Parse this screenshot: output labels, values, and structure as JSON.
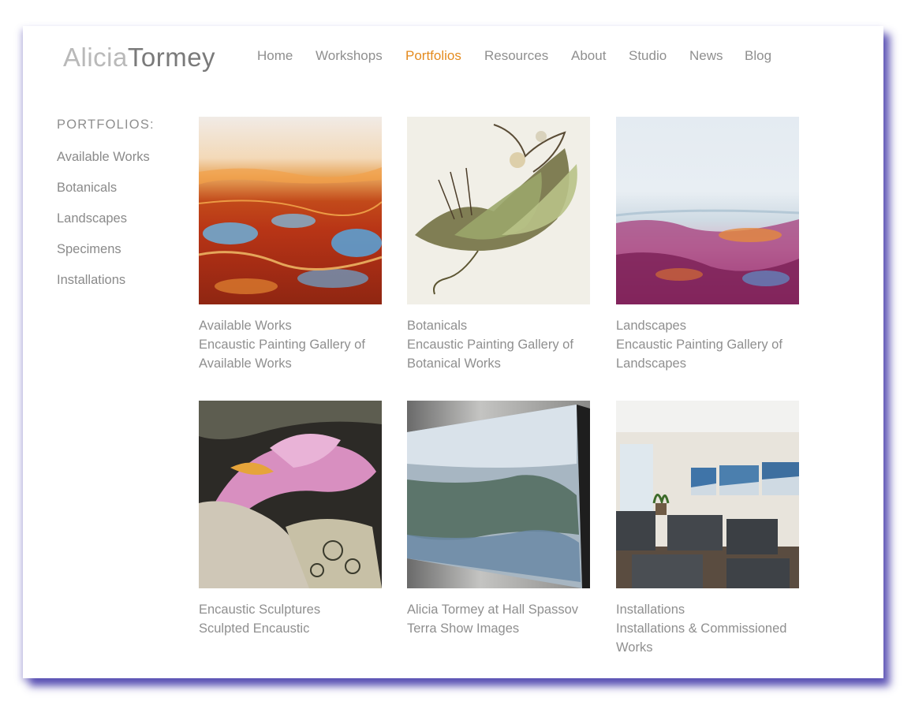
{
  "logo": {
    "first": "Alicia",
    "last": "Tormey"
  },
  "nav": [
    {
      "label": "Home",
      "active": false
    },
    {
      "label": "Workshops",
      "active": false
    },
    {
      "label": "Portfolios",
      "active": true
    },
    {
      "label": "Resources",
      "active": false
    },
    {
      "label": "About",
      "active": false
    },
    {
      "label": "Studio",
      "active": false
    },
    {
      "label": "News",
      "active": false
    },
    {
      "label": "Blog",
      "active": false
    }
  ],
  "sidebar": {
    "heading": "PORTFOLIOS:",
    "items": [
      "Available Works",
      "Botanicals",
      "Landscapes",
      "Specimens",
      "Installations"
    ]
  },
  "gallery": [
    {
      "title": "Available Works",
      "subtitle": "Encaustic Painting Gallery of Available Works"
    },
    {
      "title": "Botanicals",
      "subtitle": "Encaustic Painting Gallery of Botanical Works"
    },
    {
      "title": "Landscapes",
      "subtitle": "Encaustic Painting Gallery of Landscapes"
    },
    {
      "title": "Encaustic Sculptures",
      "subtitle": "Sculpted Encaustic"
    },
    {
      "title": "Alicia Tormey at Hall Spassov",
      "subtitle": "Terra Show Images"
    },
    {
      "title": "Installations",
      "subtitle": "Installations & Commissioned Works"
    }
  ],
  "colors": {
    "accent": "#e48b1f",
    "text": "#8f8f8f",
    "frame_shadow": "#463caa"
  }
}
